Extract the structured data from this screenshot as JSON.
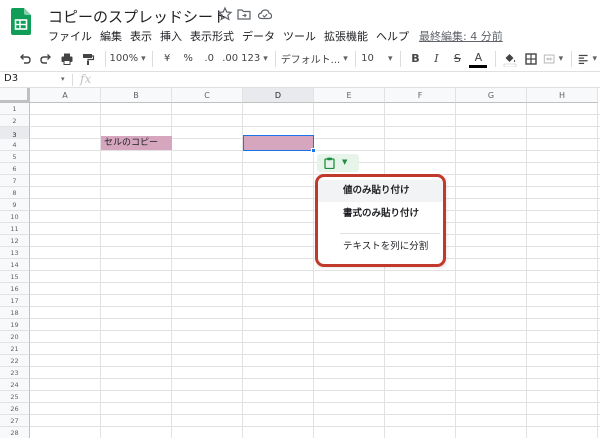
{
  "doc": {
    "title": "コピーのスプレッドシート",
    "last_edit": "最終編集: 4 分前"
  },
  "menus": [
    "ファイル",
    "編集",
    "表示",
    "挿入",
    "表示形式",
    "データ",
    "ツール",
    "拡張機能",
    "ヘルプ"
  ],
  "toolbar": {
    "zoom": "100%",
    "currency": "¥",
    "percent": "%",
    "dec_decrease": ".0",
    "dec_increase": ".00",
    "format_more": "123",
    "font": "デフォルト...",
    "font_size": "10",
    "bold": "B",
    "italic": "I",
    "strike": "S",
    "text_color": "A"
  },
  "formula_bar": {
    "cell_ref": "D3",
    "fx": "fx"
  },
  "grid": {
    "columns": [
      "A",
      "B",
      "C",
      "D",
      "E",
      "F",
      "G",
      "H"
    ],
    "selected_column": "D",
    "rows": [
      "1",
      "2",
      "3",
      "4",
      "5",
      "6",
      "7",
      "8",
      "9",
      "10",
      "11",
      "12",
      "13",
      "14",
      "15",
      "16",
      "17",
      "18",
      "19",
      "20",
      "21",
      "22",
      "23",
      "24",
      "25",
      "26",
      "27",
      "28"
    ],
    "selected_row": "3",
    "cell_b3": "セルのコピー",
    "fill_color": "#d5a6bd",
    "selection_color": "#1a73e8"
  },
  "paste_chip": {
    "icon": "clipboard-icon"
  },
  "paste_menu": {
    "items": [
      "値のみ貼り付け",
      "書式のみ貼り付け",
      "テキストを列に分割"
    ],
    "highlight_color": "#c0392b"
  }
}
